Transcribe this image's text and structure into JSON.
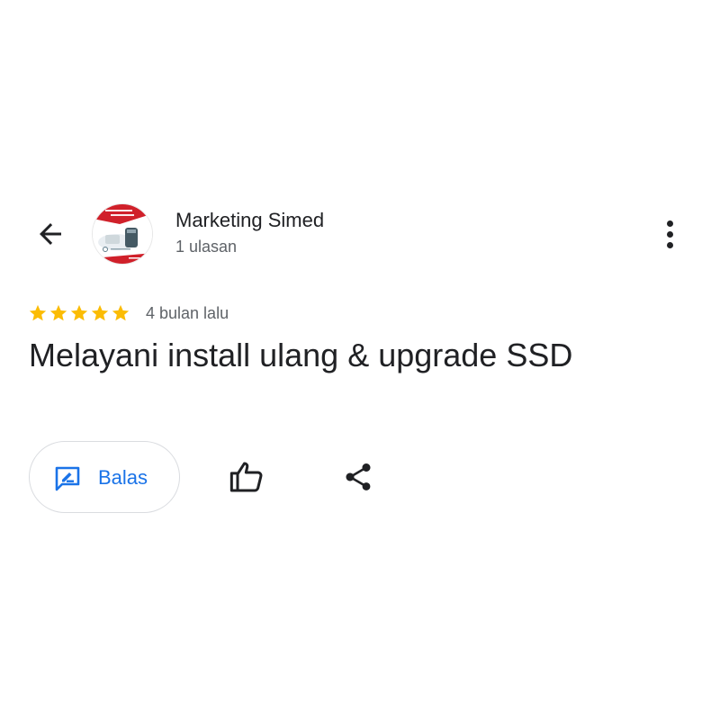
{
  "header": {
    "back_icon": "arrow-left-icon",
    "author_name": "Marketing Simed",
    "review_count": "1 ulasan",
    "menu_icon": "more-vert-icon",
    "avatar_text": {
      "headline": "The Best Solution for your environment",
      "caption": "Jasa Instalasi • Service"
    }
  },
  "review": {
    "rating": 5,
    "rating_max": 5,
    "star_color": "#fbbc04",
    "time_ago": "4 bulan lalu",
    "text": "Melayani install ulang & upgrade SSD"
  },
  "actions": {
    "reply_label": "Balas",
    "reply_icon": "rate-review-icon",
    "like_icon": "thumb-up-icon",
    "share_icon": "share-icon",
    "accent_color": "#1a73e8"
  }
}
